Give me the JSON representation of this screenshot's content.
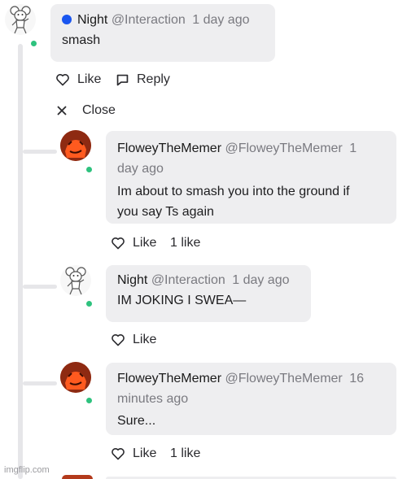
{
  "top_comment": {
    "name": "Night",
    "handle": "@Interaction",
    "time": "1 day ago",
    "body": "smash",
    "like_label": "Like",
    "reply_label": "Reply"
  },
  "close_label": "Close",
  "replies": [
    {
      "name": "FloweyTheMemer",
      "handle": "@FloweyTheMemer",
      "time_part1": "1",
      "time_part2": "day ago",
      "body_line1": "Im about to smash you into the ground if",
      "body_line2": "you say Ts again",
      "like_label": "Like",
      "likes": "1 like"
    },
    {
      "name": "Night",
      "handle": "@Interaction",
      "time": "1 day ago",
      "body": "IM JOKING I SWEA—",
      "like_label": "Like"
    },
    {
      "name": "FloweyTheMemer",
      "handle": "@FloweyTheMemer",
      "time_part1": "16",
      "time_part2": "minutes ago",
      "body": "Sure...",
      "like_label": "Like",
      "likes": "1 like"
    }
  ],
  "watermark": "imgflip.com",
  "colors": {
    "online": "#2ec27e",
    "status": "#1a56f0",
    "bubble": "#eeeef0"
  }
}
